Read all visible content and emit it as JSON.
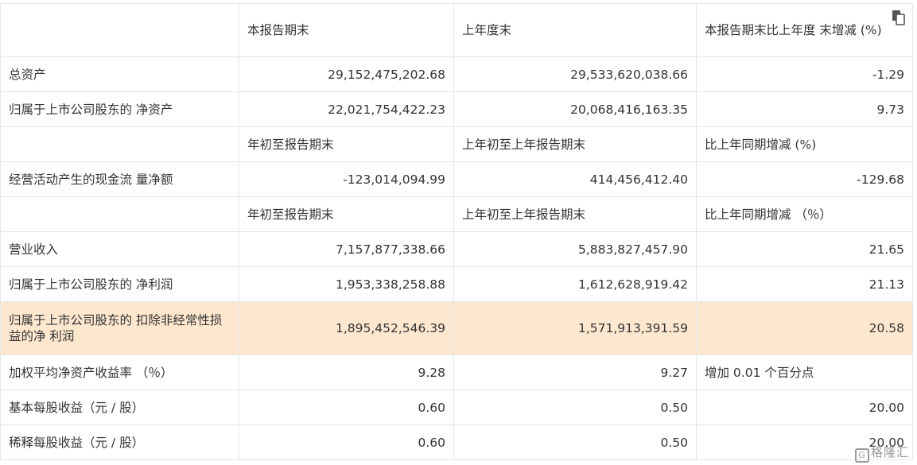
{
  "header": {
    "blank": "",
    "col1": "本报告期末",
    "col2": "上年度末",
    "col3": "本报告期末比上年度 末增减 (%)"
  },
  "rows_a": [
    {
      "label": "总资产",
      "v1": "29,152,475,202.68",
      "v2": "29,533,620,038.66",
      "v3": "-1.29"
    },
    {
      "label": "归属于上市公司股东的 净资产",
      "v1": "22,021,754,422.23",
      "v2": "20,068,416,163.35",
      "v3": "9.73"
    }
  ],
  "subheader_b": {
    "col1": "年初至报告期末",
    "col2": "上年初至上年报告期末",
    "col3": "比上年同期增减 (%)"
  },
  "rows_b": [
    {
      "label": "经营活动产生的现金流 量净额",
      "v1": "-123,014,094.99",
      "v2": "414,456,412.40",
      "v3": "-129.68"
    }
  ],
  "subheader_c": {
    "col1": "年初至报告期末",
    "col2": "上年初至上年报告期末",
    "col3": "比上年同期增减 （％）"
  },
  "rows_c": [
    {
      "label": "营业收入",
      "v1": "7,157,877,338.66",
      "v2": "5,883,827,457.90",
      "v3": "21.65"
    },
    {
      "label": "归属于上市公司股东的 净利润",
      "v1": "1,953,338,258.88",
      "v2": "1,612,628,919.42",
      "v3": "21.13"
    },
    {
      "label": "归属于上市公司股东的 扣除非经常性损益的净 利润",
      "v1": "1,895,452,546.39",
      "v2": "1,571,913,391.59",
      "v3": "20.58"
    },
    {
      "label": "加权平均净资产收益率 （％）",
      "v1": "9.28",
      "v2": "9.27",
      "v3": "增加 0.01 个百分点"
    },
    {
      "label": "基本每股收益（元 / 股）",
      "v1": "0.60",
      "v2": "0.50",
      "v3": "20.00"
    },
    {
      "label": "稀释每股收益（元 / 股）",
      "v1": "0.60",
      "v2": "0.50",
      "v3": "20.00"
    }
  ],
  "colors": {
    "highlight_row": "#fde8cf",
    "border": "#e6e6e6",
    "text": "#333333"
  },
  "icons": {
    "copy": "copy-icon"
  },
  "watermark": "格隆汇"
}
